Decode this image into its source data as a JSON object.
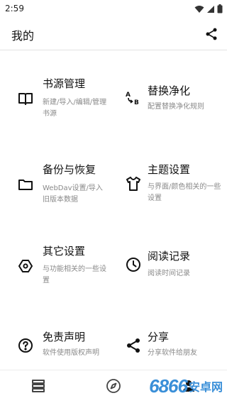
{
  "status": {
    "time": "2:59"
  },
  "appbar": {
    "title": "我的"
  },
  "cards": [
    {
      "title": "书源管理",
      "desc": "新建/导入/编辑/管理书源",
      "icon": "book-icon"
    },
    {
      "title": "替换净化",
      "desc": "配置替换净化规则",
      "icon": "replace-ab-icon"
    },
    {
      "title": "备份与恢复",
      "desc": "WebDav设置/导入旧版本数据",
      "icon": "folder-icon"
    },
    {
      "title": "主题设置",
      "desc": "与界面/颜色相关的一些设置",
      "icon": "tshirt-icon"
    },
    {
      "title": "其它设置",
      "desc": "与功能相关的一些设置",
      "icon": "settings-hexagon-icon"
    },
    {
      "title": "阅读记录",
      "desc": "阅读时间记录",
      "icon": "clock-icon"
    },
    {
      "title": "免责声明",
      "desc": "软件使用版权声明",
      "icon": "help-circle-icon"
    },
    {
      "title": "分享",
      "desc": "分享软件给朋友",
      "icon": "share-icon"
    }
  ],
  "bottom_nav": [
    {
      "name": "bookshelf",
      "icon": "bookshelf-icon"
    },
    {
      "name": "discover",
      "icon": "compass-icon"
    },
    {
      "name": "my",
      "icon": "person-icon"
    }
  ],
  "watermark": {
    "number": "6866",
    "text": "安卓网"
  }
}
